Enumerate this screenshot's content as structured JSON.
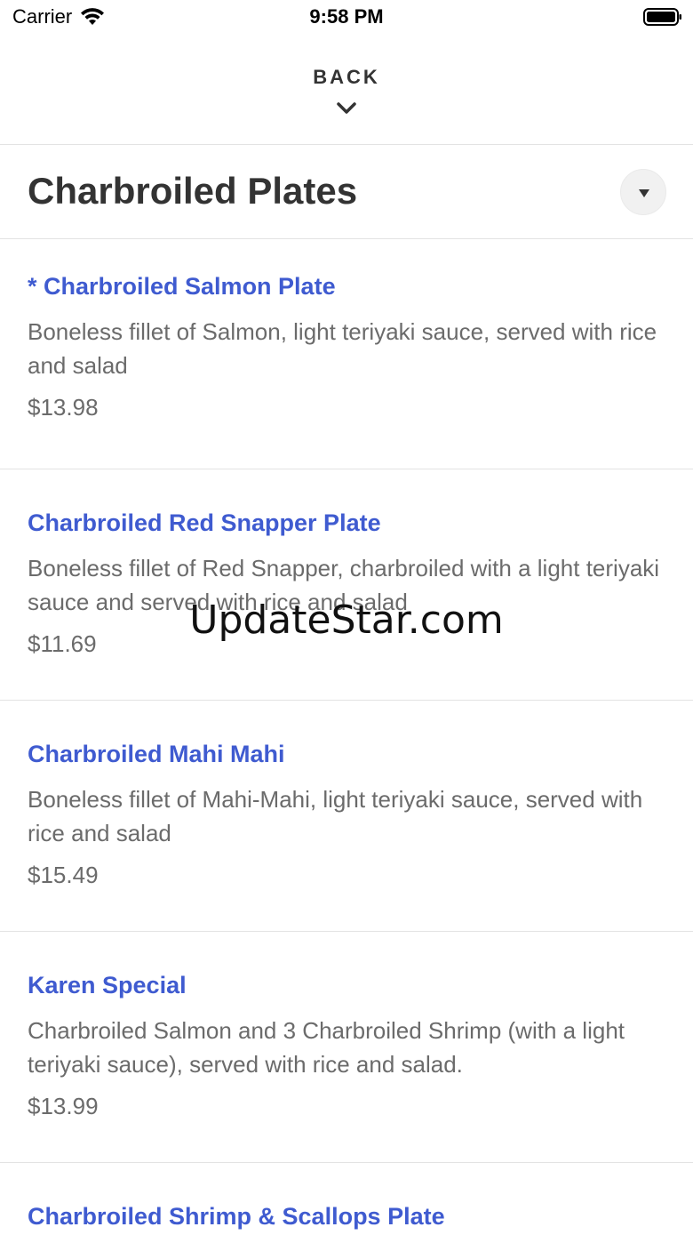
{
  "status_bar": {
    "carrier": "Carrier",
    "time": "9:58 PM",
    "icons": [
      "wifi-icon",
      "battery-icon"
    ]
  },
  "nav": {
    "back_label": "BACK",
    "icon": "chevron-down-icon"
  },
  "section": {
    "title": "Charbroiled Plates",
    "toggle_icon": "triangle-down-icon"
  },
  "colors": {
    "item_name": "#3f5bd0",
    "text_muted": "#6b6b6b",
    "heading": "#333333",
    "divider": "#e3e3e3"
  },
  "menu_items": [
    {
      "name": "* Charbroiled Salmon Plate",
      "description": "Boneless fillet of Salmon, light teriyaki sauce, served with rice and salad",
      "price": "$13.98"
    },
    {
      "name": "Charbroiled Red Snapper Plate",
      "description": "Boneless fillet of Red Snapper, charbroiled with a light teriyaki sauce and served with rice and salad",
      "price": "$11.69"
    },
    {
      "name": "Charbroiled Mahi Mahi",
      "description": "Boneless fillet of Mahi-Mahi, light teriyaki sauce, served with rice and salad",
      "price": "$15.49"
    },
    {
      "name": "Karen Special",
      "description": "Charbroiled Salmon and 3 Charbroiled Shrimp (with a light teriyaki sauce), served with rice and salad.",
      "price": "$13.99"
    },
    {
      "name": "Charbroiled Shrimp & Scallops Plate",
      "description": "",
      "price": ""
    }
  ],
  "watermark": "UpdateStar.com"
}
